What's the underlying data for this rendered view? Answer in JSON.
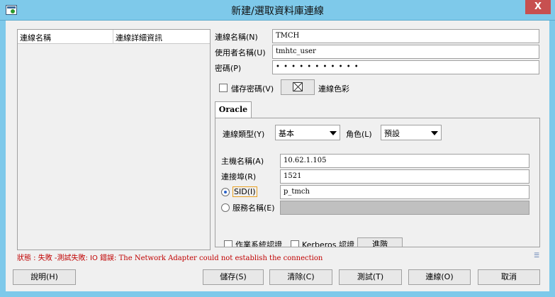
{
  "window": {
    "title": "新建/選取資料庫連線",
    "close_label": "X"
  },
  "connection_list": {
    "columns": [
      "連線名稱",
      "連線詳細資訊"
    ]
  },
  "form": {
    "conn_name_label": "連線名稱(N)",
    "conn_name_value": "TMCH",
    "user_label": "使用者名稱(U)",
    "user_value": "tmhtc_user",
    "password_label": "密碼(P)",
    "password_mask": "• • • • • • • • • • •",
    "save_password_label": "儲存密碼(V)",
    "save_password_checked": false,
    "color_label": "連線色彩"
  },
  "tabs": {
    "active": "Oracle"
  },
  "oracle": {
    "conn_type_label": "連線類型(Y)",
    "conn_type_value": "基本",
    "role_label": "角色(L)",
    "role_value": "預設",
    "host_label": "主機名稱(A)",
    "host_value": "10.62.1.105",
    "port_label": "連接埠(R)",
    "port_value": "1521",
    "sid_label": "SID(I)",
    "sid_value": "p_tmch",
    "sid_selected": true,
    "service_label": "服務名稱(E)",
    "service_value": "",
    "os_auth_label": "作業系統認證",
    "kerberos_label": "Kerberos 認證",
    "advanced_label": "進階"
  },
  "status": {
    "prefix": "狀態 : 失敗 -測試失敗: IO 錯誤: ",
    "message": "The Network Adapter could not establish the connection"
  },
  "buttons": {
    "help": "說明(H)",
    "save": "儲存(S)",
    "clear": "清除(C)",
    "test": "測試(T)",
    "connect": "連線(O)",
    "cancel": "取消"
  },
  "colors": {
    "titlebar": "#7ec9ea",
    "close": "#c75050",
    "status_error": "#c00000"
  }
}
